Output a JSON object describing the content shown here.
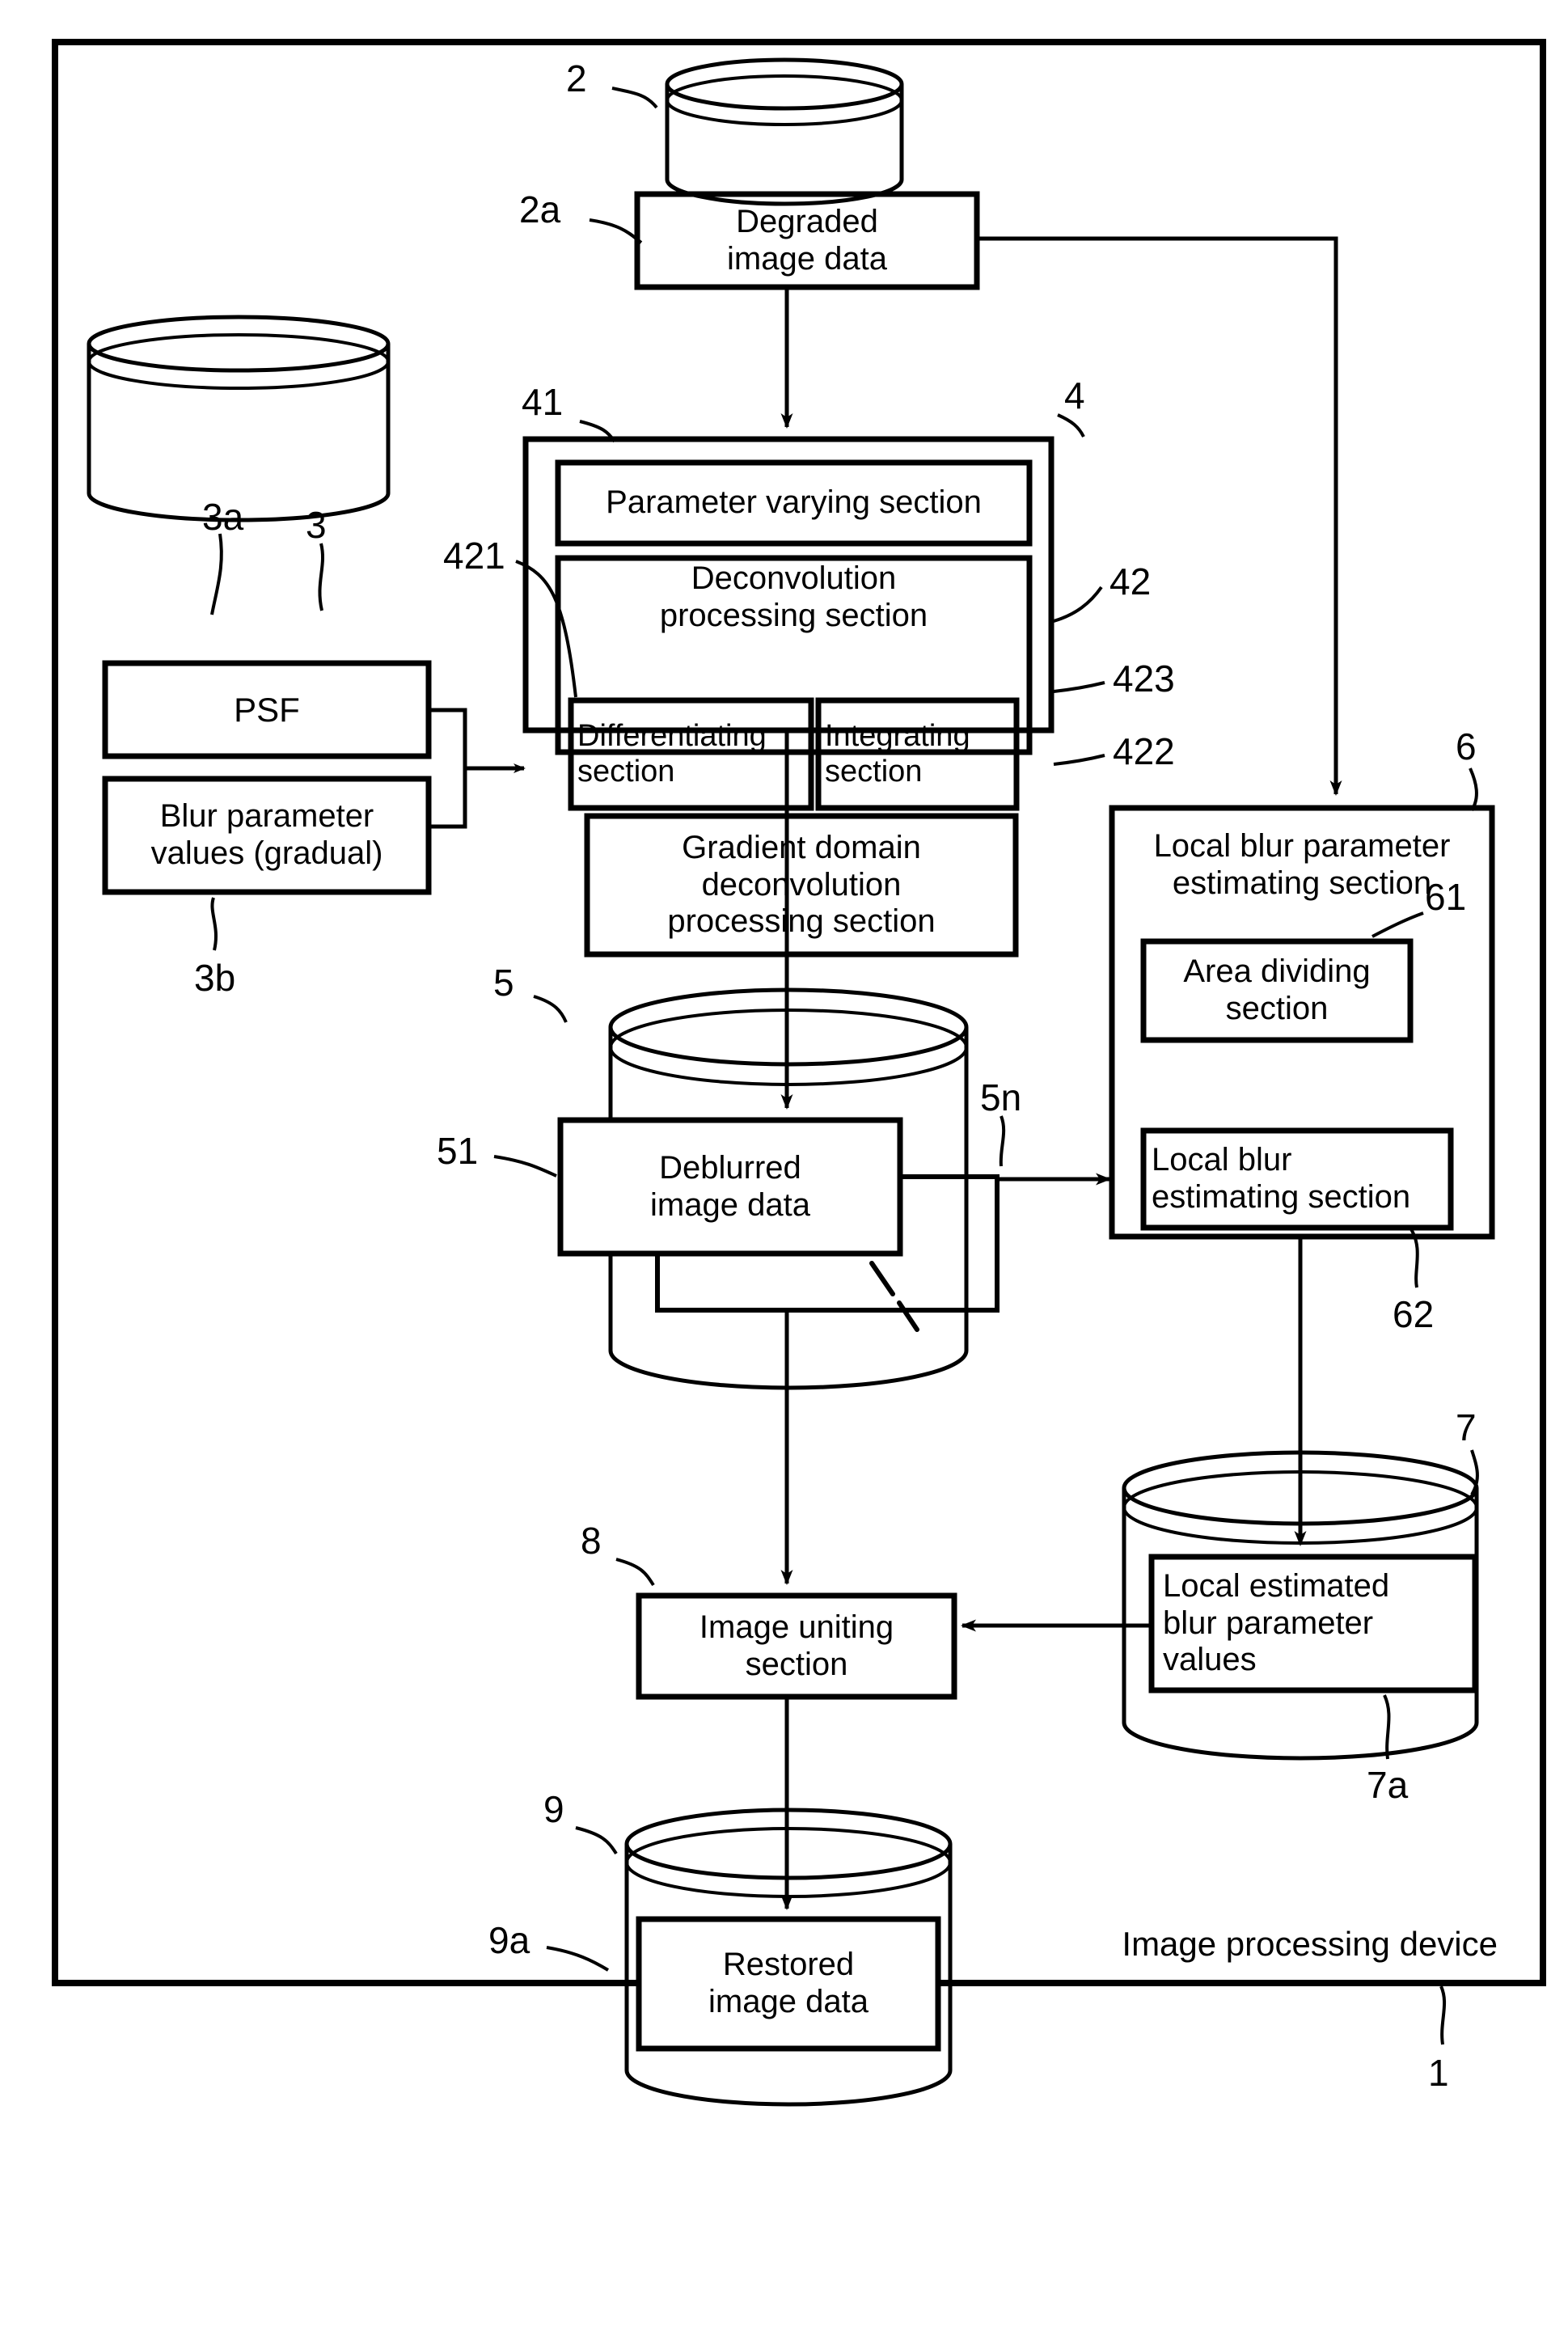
{
  "figure": {
    "type": "patent-block-diagram",
    "device_label": "Image processing device",
    "device_ref": "1"
  },
  "nodes": {
    "degraded_store": {
      "ref": "2",
      "inner_ref": "2a",
      "inner_label": "Degraded\nimage data",
      "shape": "cylinder"
    },
    "psf_store": {
      "ref": "3",
      "inner_ref_top": "3a",
      "inner_ref_bottom": "3b",
      "inner_label_top": "PSF",
      "inner_label_bottom": "Blur parameter\nvalues (gradual)",
      "shape": "cylinder"
    },
    "deblur_unit": {
      "ref": "4",
      "shape": "box",
      "children": {
        "param_varying": {
          "ref": "41",
          "label": "Parameter varying section"
        },
        "deconvolution": {
          "ref": "42",
          "label": "Deconvolution\nprocessing section"
        },
        "differentiating": {
          "ref": "421",
          "label": "Differentiating\nsection"
        },
        "integrating": {
          "ref": "423",
          "label": "Integrating\nsection"
        },
        "gradient_domain": {
          "ref": "422",
          "label": "Gradient  domain\ndeconvolution\nprocessing  section"
        }
      }
    },
    "deblurred_store": {
      "ref": "5",
      "inner_ref": "51",
      "stack_ref": "5n",
      "inner_label": "Deblurred\nimage data",
      "shape": "cylinder"
    },
    "local_blur_unit": {
      "ref": "6",
      "label": "Local blur parameter\nestimating section",
      "shape": "box",
      "children": {
        "area_dividing": {
          "ref": "61",
          "label": "Area dividing\nsection"
        },
        "local_blur_estimating": {
          "ref": "62",
          "label": "Local blur\nestimating section"
        }
      }
    },
    "local_estimated_store": {
      "ref": "7",
      "inner_ref": "7a",
      "inner_label": "Local estimated\nblur parameter\nvalues",
      "shape": "cylinder"
    },
    "image_uniting": {
      "ref": "8",
      "label": "Image uniting\nsection",
      "shape": "box"
    },
    "restored_store": {
      "ref": "9",
      "inner_ref": "9a",
      "inner_label": "Restored\nimage data",
      "shape": "cylinder"
    }
  },
  "colors": {
    "ink": "#000000",
    "paper": "#ffffff"
  }
}
